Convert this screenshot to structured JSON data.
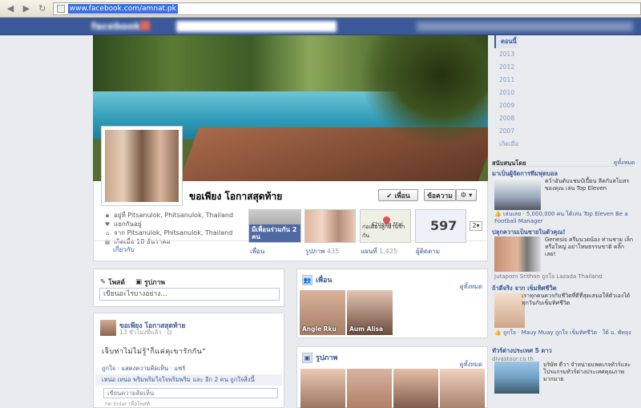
{
  "browser": {
    "url": "www.facebook.com/amnat.pk"
  },
  "profile": {
    "name": "ขอเพียง โอกาสสุดท้าย",
    "friends_button": "✔ เพื่อน",
    "message_button": "ข้อความ",
    "settings_button": "⚙ ▾",
    "info": [
      {
        "icon": "work-icon",
        "label": "อยู่ที่ Pitsanulok, Phitsanulok, Thailand"
      },
      {
        "icon": "heart-icon",
        "label": "แยกกันอยู่"
      },
      {
        "icon": "home-icon",
        "label": "จาก Pitsanulok, Phitsanulok, Thailand"
      },
      {
        "icon": "calendar-icon",
        "label": "เกิดเมื่อ 18 ธันวาคม"
      }
    ],
    "about_link": "เกี่ยวกับ"
  },
  "tiles": {
    "friends": {
      "label": "เพื่อน",
      "overlay": "มีเพื่อนร่วมกัน 2 คน"
    },
    "photos": {
      "label": "รูปภาพ",
      "count": "435"
    },
    "map": {
      "label": "แผนที่",
      "count": "1,425",
      "city": "Chiang Mai",
      "caption": "ก่อเดียวลูกบ้านรักกัน"
    },
    "likes": {
      "label": "ผู้ติดตาม",
      "count": "597"
    },
    "more_badge": "2▾"
  },
  "composer": {
    "tab_post": "โพสต์",
    "tab_photo": "รูปภาพ",
    "placeholder": "เขียนอะไรบางอย่าง..."
  },
  "post": {
    "author": "ขอเพียง โอกาสสุดท้าย",
    "time": "13 ชั่วโมงที่แล้ว · ⛭",
    "text": "เจ็บท่าไม่ไม่รู้\"ก็แค่คุเขารักกัน\"",
    "actions": "ถูกใจ · แสดงความคิดเห็น · แชร์",
    "likes": "เหน่อ เหน่อ พริมพริมใจใจพริมพริม และ อีก 2 คน ถูกใจสิ่งนี้",
    "comment_placeholder": "เขียนความคิดเห็น",
    "comment_hint": "กด Enter เพื่อโพสต์"
  },
  "friends_section": {
    "title": "เพื่อน",
    "see_all": "ดูทั้งหมด",
    "items": [
      {
        "name": "Angle Rku"
      },
      {
        "name": "Aum Alisa"
      }
    ]
  },
  "photos_section": {
    "title": "รูปภาพ",
    "see_all": "ดูทั้งหมด"
  },
  "years": [
    "ตอนนี้",
    "2013",
    "2012",
    "2011",
    "2010",
    "2009",
    "2008",
    "2007",
    "เกิดเมื่อ"
  ],
  "sidebar": {
    "sponsored": "สนับสนุนโดย",
    "see_all": "ดูทั้งหมด",
    "ads": [
      {
        "title": "มาเป็นผู้จัดการทีมฟุตบอล",
        "text": "คว้าอันดับแชมป์เปี้ยน ลีคกับสโมสรของคุณ เล่น Top Eleven",
        "meta": "👍 เล่นเลย · 5,000,000 คน ได้เล่น Top Eleven Be a Football Manager"
      },
      {
        "title": "ปลุกความเป็นชายในตัวคุณ!",
        "text": "Genesis ครีมนวดน้อง ท่านชาย เล็กหรือใหญ่ อย่าโทษธรรมชาติ คลิ๊กเลย!",
        "meta": "Jutaporn Srithon ถูกใจ Lazada Thailand"
      },
      {
        "title": "ถ้าดีจริง จาก เข็มทิศชีวิต",
        "text": "เราทุกคนควรกับชีวิตที่ดีที่สุดเสมอให้ตัวเองได้ทุกวันกับเข็มทิศชีวิต",
        "meta": "👍 ถูกใจ · Mauy Muay ถูกใจ เข็มทิศชีวิต · ใต้ อ. พัทลุง"
      },
      {
        "title": "ทัวร์ต่างประเทศ 5 ดาว",
        "sub": "divastour.co.th",
        "text": "บริษัท ดีวา จำหน่ายแพคเกจทัวร์และโปรแกรมทัวร์ต่างประเทศคุณภาพมากมาย"
      }
    ]
  }
}
